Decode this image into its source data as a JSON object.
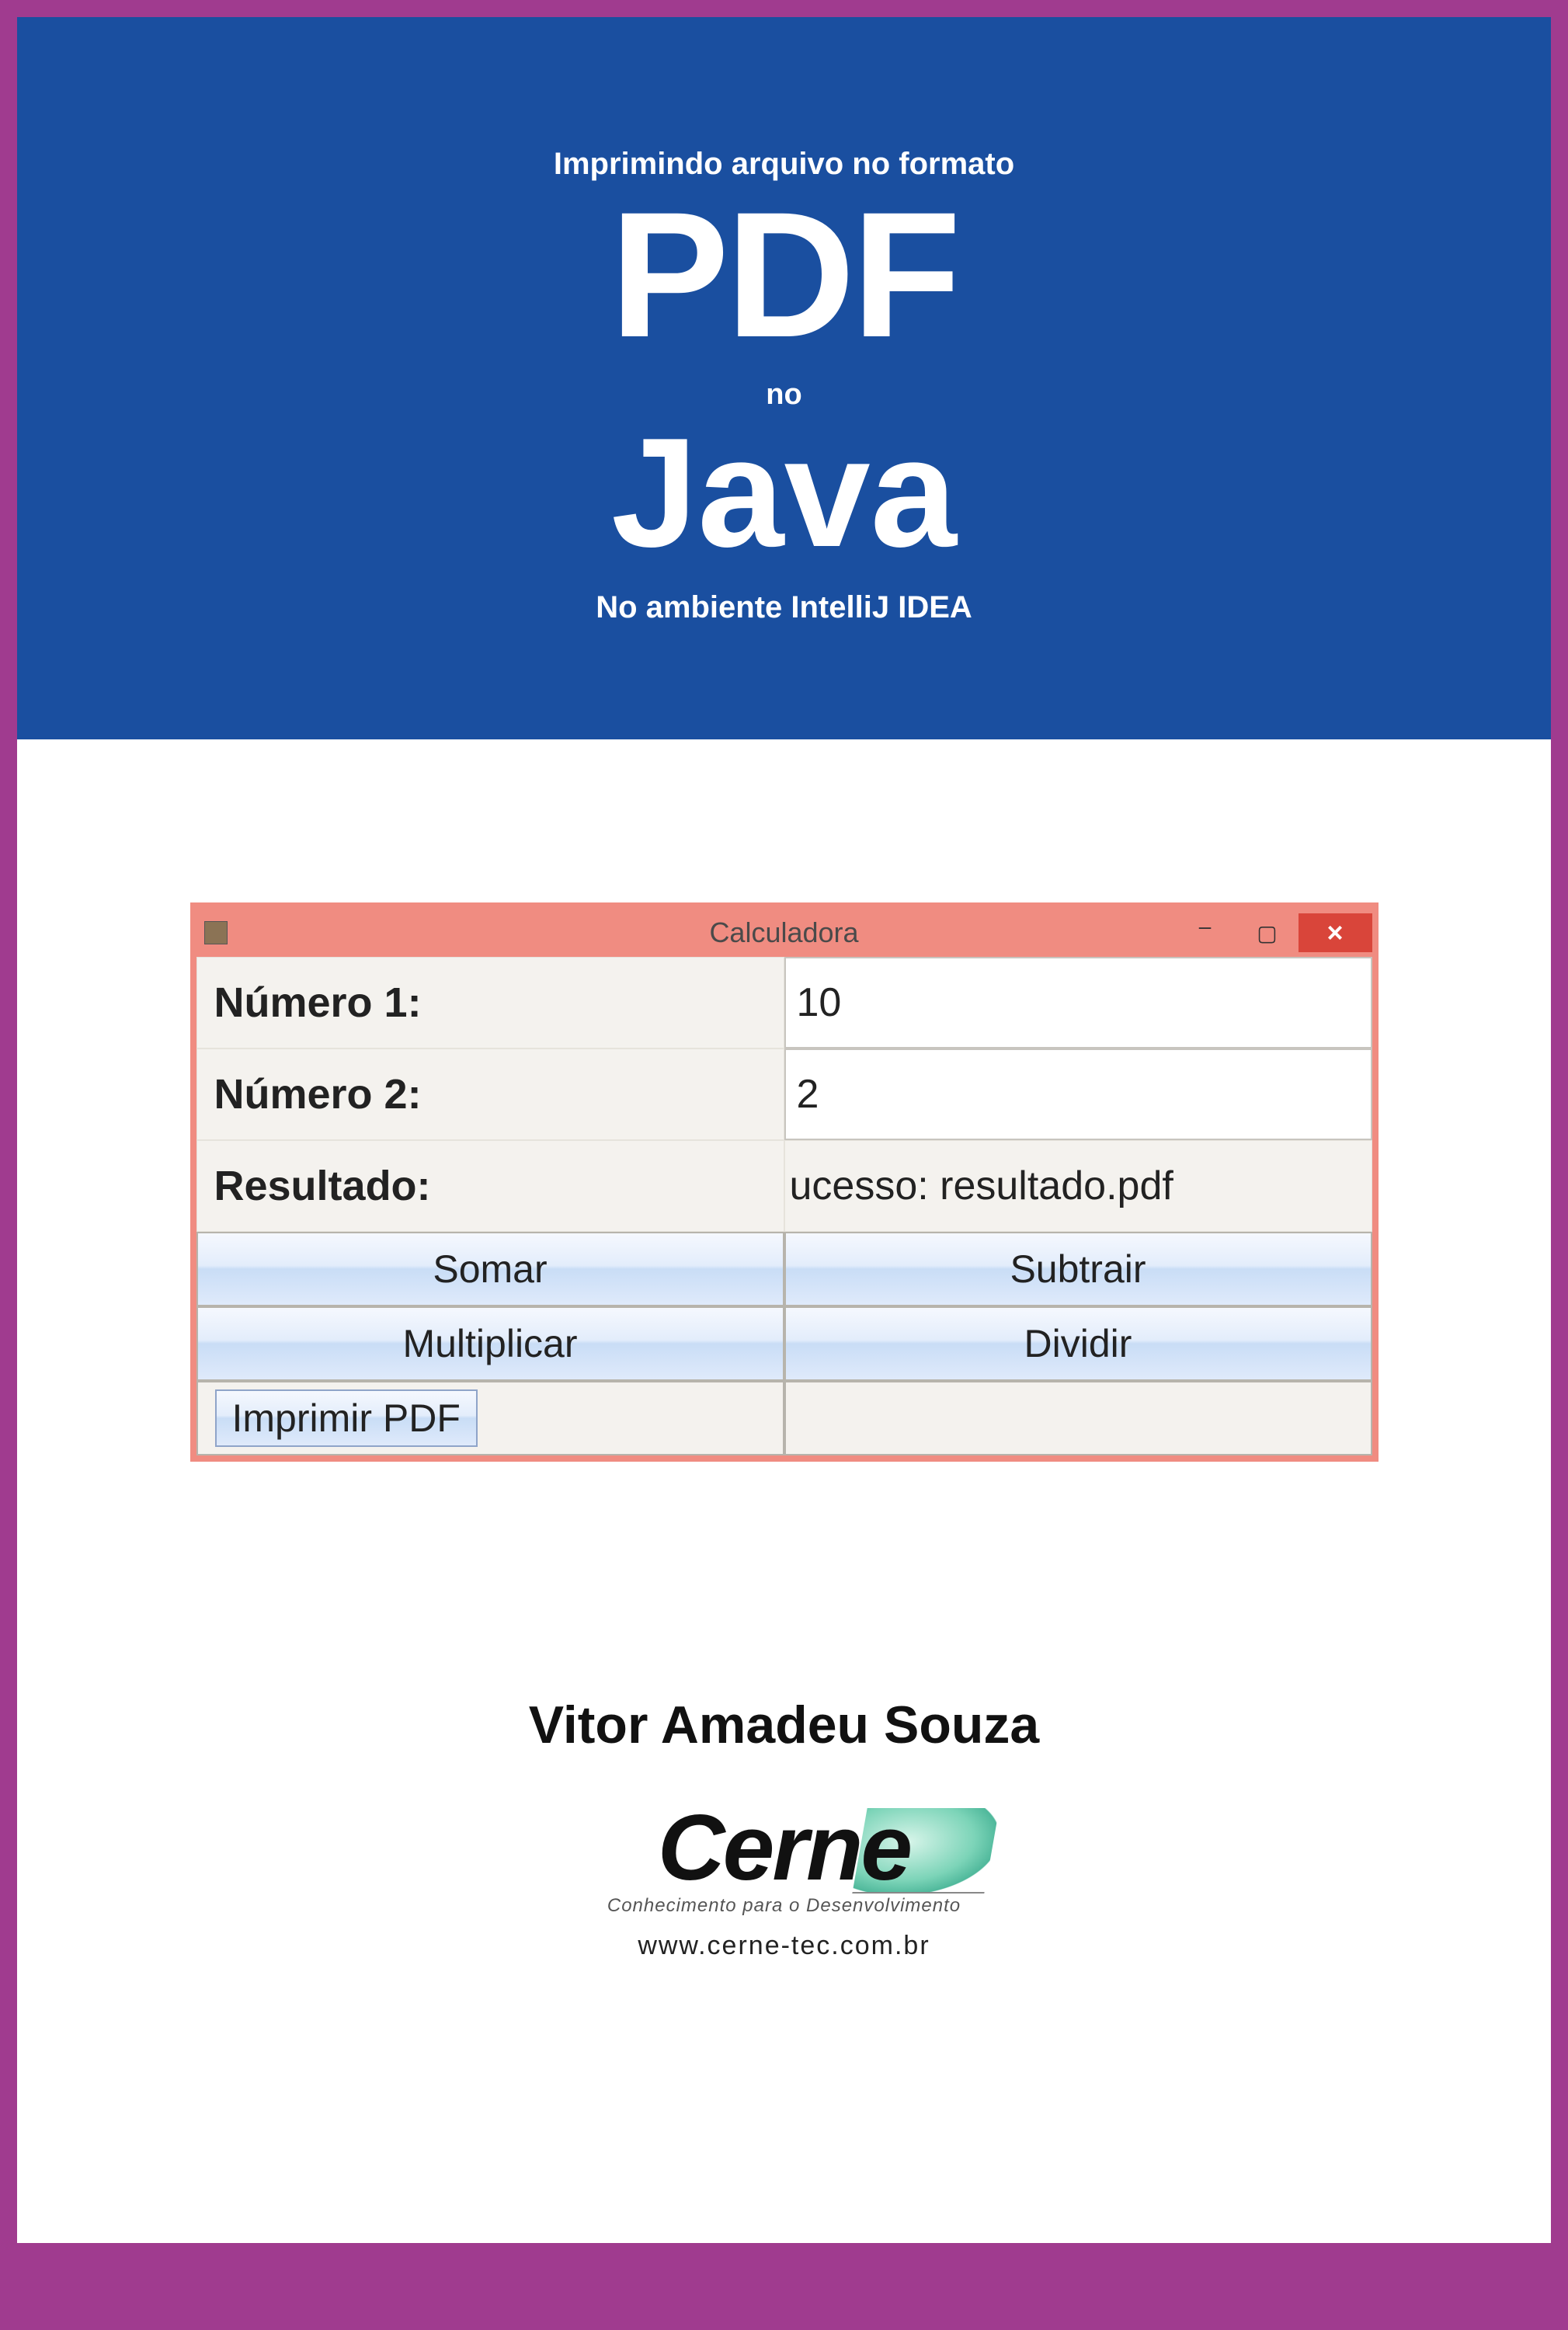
{
  "header": {
    "pretitle": "Imprimindo arquivo no formato",
    "title1": "PDF",
    "connector": "no",
    "title2": "Java",
    "subtitle": "No ambiente IntelliJ IDEA"
  },
  "window": {
    "title": "Calculadora",
    "controls": {
      "min": "–",
      "max": "▢",
      "close": "×"
    },
    "rows": {
      "num1_label": "Número 1:",
      "num1_value": "10",
      "num2_label": "Número 2:",
      "num2_value": "2",
      "result_label": "Resultado:",
      "result_value": "ucesso: resultado.pdf"
    },
    "buttons": {
      "somar": "Somar",
      "subtrair": "Subtrair",
      "multiplicar": "Multiplicar",
      "dividir": "Dividir",
      "imprimir": "Imprimir PDF"
    }
  },
  "author": "Vitor Amadeu Souza",
  "logo": {
    "name": "Cerne",
    "tagline": "Conhecimento para o Desenvolvimento",
    "url": "www.cerne-tec.com.br"
  },
  "colors": {
    "frame": "#a03b8f",
    "header_bg": "#1a4fa0",
    "window_border": "#f08c81",
    "close_btn": "#d9453a"
  }
}
